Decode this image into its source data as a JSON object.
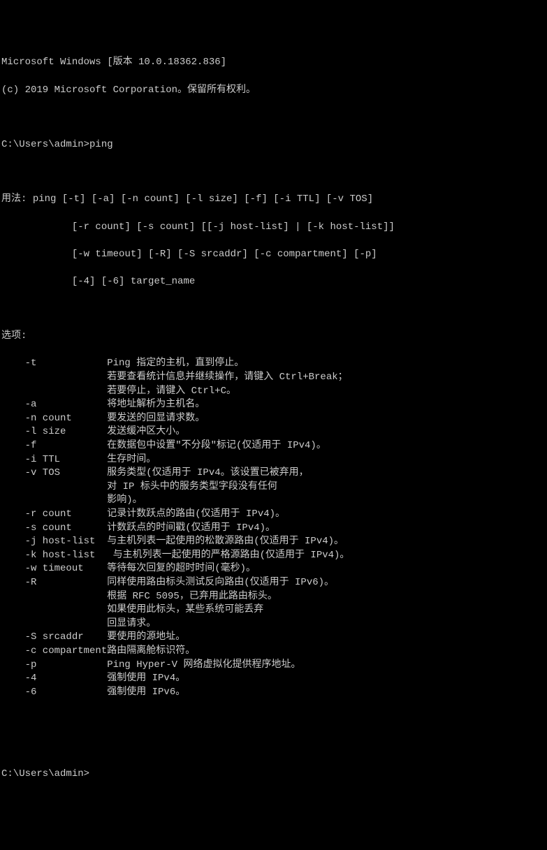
{
  "header": {
    "line1": "Microsoft Windows [版本 10.0.18362.836]",
    "line2": "(c) 2019 Microsoft Corporation。保留所有权利。"
  },
  "prompt1": {
    "path": "C:\\Users\\admin>",
    "command": "ping"
  },
  "usage": {
    "label": "用法:",
    "lines": [
      "ping [-t] [-a] [-n count] [-l size] [-f] [-i TTL] [-v TOS]",
      "[-r count] [-s count] [[-j host-list] | [-k host-list]]",
      "[-w timeout] [-R] [-S srcaddr] [-c compartment] [-p]",
      "[-4] [-6] target_name"
    ]
  },
  "options": {
    "label": "选项:",
    "items": [
      {
        "flag": "-t",
        "desc": [
          "Ping 指定的主机，直到停止。",
          "若要查看统计信息并继续操作，请键入 Ctrl+Break；",
          "若要停止，请键入 Ctrl+C。"
        ]
      },
      {
        "flag": "-a",
        "desc": [
          "将地址解析为主机名。"
        ]
      },
      {
        "flag": "-n count",
        "desc": [
          "要发送的回显请求数。"
        ]
      },
      {
        "flag": "-l size",
        "desc": [
          "发送缓冲区大小。"
        ]
      },
      {
        "flag": "-f",
        "desc": [
          "在数据包中设置\"不分段\"标记(仅适用于 IPv4)。"
        ]
      },
      {
        "flag": "-i TTL",
        "desc": [
          "生存时间。"
        ]
      },
      {
        "flag": "-v TOS",
        "desc": [
          "服务类型(仅适用于 IPv4。该设置已被弃用，",
          "对 IP 标头中的服务类型字段没有任何",
          "影响)。"
        ]
      },
      {
        "flag": "-r count",
        "desc": [
          "记录计数跃点的路由(仅适用于 IPv4)。"
        ]
      },
      {
        "flag": "-s count",
        "desc": [
          "计数跃点的时间戳(仅适用于 IPv4)。"
        ]
      },
      {
        "flag": "-j host-list",
        "desc": [
          "与主机列表一起使用的松散源路由(仅适用于 IPv4)。"
        ]
      },
      {
        "flag": "-k host-list",
        "desc": [
          " 与主机列表一起使用的严格源路由(仅适用于 IPv4)。"
        ]
      },
      {
        "flag": "-w timeout",
        "desc": [
          "等待每次回复的超时时间(毫秒)。"
        ]
      },
      {
        "flag": "-R",
        "desc": [
          "同样使用路由标头测试反向路由(仅适用于 IPv6)。",
          "根据 RFC 5095，已弃用此路由标头。",
          "如果使用此标头，某些系统可能丢弃",
          "回显请求。"
        ]
      },
      {
        "flag": "-S srcaddr",
        "desc": [
          "要使用的源地址。"
        ]
      },
      {
        "flag": "-c compartment",
        "desc": [
          "路由隔离舱标识符。"
        ]
      },
      {
        "flag": "-p",
        "desc": [
          "Ping Hyper-V 网络虚拟化提供程序地址。"
        ]
      },
      {
        "flag": "-4",
        "desc": [
          "强制使用 IPv4。"
        ]
      },
      {
        "flag": "-6",
        "desc": [
          "强制使用 IPv6。"
        ]
      }
    ]
  },
  "prompt2": {
    "path": "C:\\Users\\admin>"
  }
}
